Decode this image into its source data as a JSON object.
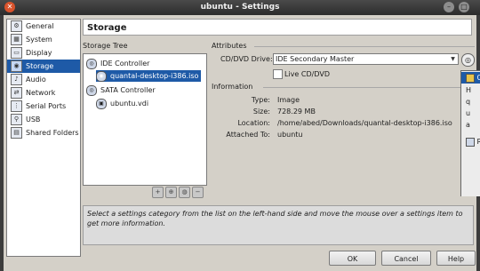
{
  "window": {
    "title": "ubuntu - Settings"
  },
  "categories": [
    "General",
    "System",
    "Display",
    "Storage",
    "Audio",
    "Network",
    "Serial Ports",
    "USB",
    "Shared Folders"
  ],
  "selected_category": "Storage",
  "page_title": "Storage",
  "storage_tree": {
    "label": "Storage Tree",
    "ide_controller": "IDE Controller",
    "ide_attachment": "quantal-desktop-i386.iso",
    "sata_controller": "SATA Controller",
    "sata_attachment": "ubuntu.vdi"
  },
  "attributes": {
    "label": "Attributes",
    "drive_label": "CD/DVD Drive:",
    "drive_value": "IDE Secondary Master",
    "live_cd_label": "Live CD/DVD",
    "live_cd_checked": false
  },
  "information": {
    "label": "Information",
    "rows": [
      {
        "key": "Type:",
        "value": "Image"
      },
      {
        "key": "Size:",
        "value": "728.29 MB"
      },
      {
        "key": "Location:",
        "value": "/home/abed/Downloads/quantal-desktop-i386.iso"
      },
      {
        "key": "Attached To:",
        "value": "ubuntu"
      }
    ]
  },
  "description": "Select a settings category from the list on the left-hand side and move the mouse over a settings item to get more information.",
  "buttons": {
    "ok": "OK",
    "cancel": "Cancel",
    "help": "Help"
  },
  "popup_menu": {
    "items": [
      "C",
      "H",
      "q",
      "u",
      "a",
      "R"
    ],
    "selected_index": 0
  }
}
